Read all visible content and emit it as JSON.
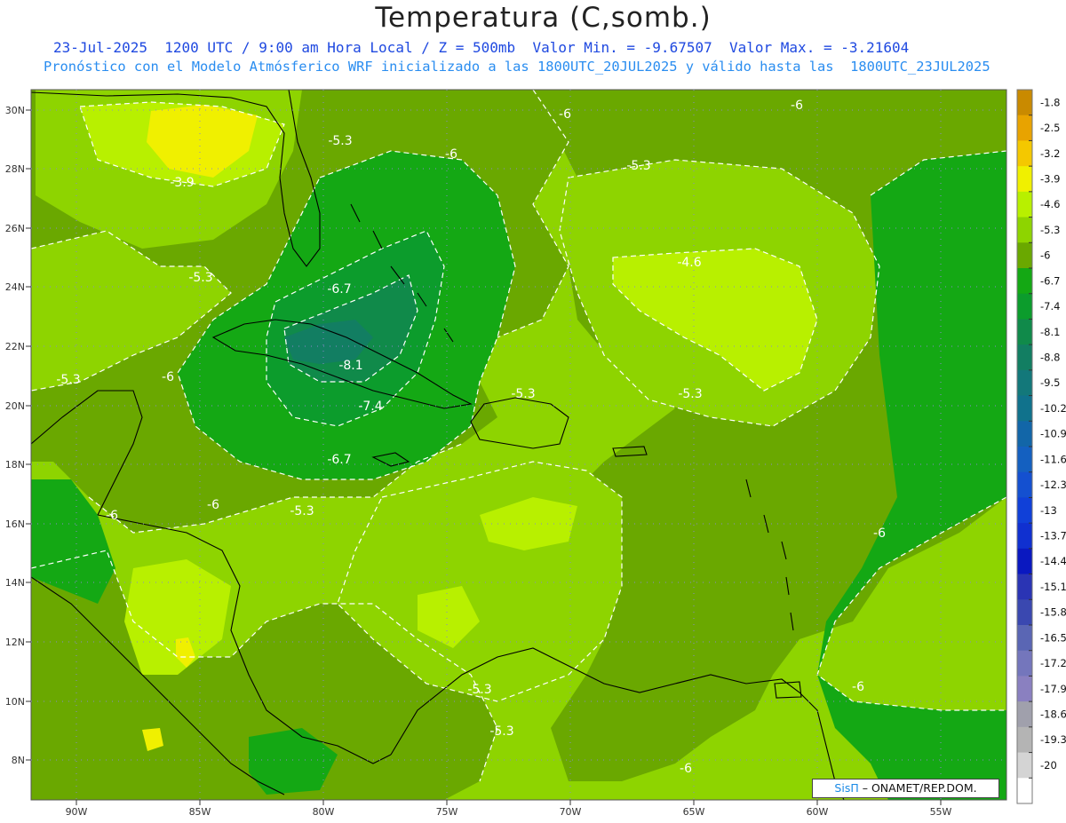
{
  "header": {
    "title": "Temperatura (C,somb.)",
    "line1": "23-Jul-2025  1200 UTC / 9:00 am Hora Local / Z = 500mb  Valor Min. = -9.67507  Valor Max. = -3.21604",
    "line2": "Pronóstico con el Modelo Atmósferico WRF inicializado a las 1800UTC_20JUL2025 y válido hasta las  1800UTC_23JUL2025"
  },
  "map": {
    "lat_ticks": [
      "30N",
      "28N",
      "26N",
      "24N",
      "22N",
      "20N",
      "18N",
      "16N",
      "14N",
      "12N",
      "10N",
      "8N"
    ],
    "lon_ticks": [
      "90W",
      "85W",
      "80W",
      "75W",
      "70W",
      "65W",
      "60W",
      "55W"
    ],
    "contour_labels": [
      "-6",
      "-6",
      "-5.3",
      "-6",
      "-5.3",
      "-3.9",
      "-5.3",
      "-6.7",
      "-4.6",
      "-5.3",
      "-6",
      "-8.1",
      "-5.3",
      "-5.3",
      "-7.4",
      "-6.7",
      "-6",
      "-5.3",
      "-6",
      "-6",
      "-5.3",
      "-5.3",
      "-6",
      "-6"
    ],
    "field_colors": {
      "c_1_8": "#c98a00",
      "c_2_5": "#e8a300",
      "c_3_2": "#f4c800",
      "c_3_9": "#f0f000",
      "c_4_6": "#b8f000",
      "c_5_3": "#8ed400",
      "c_6": "#6aa800",
      "c_6_7": "#14a814",
      "c_7_4": "#0c9c2c",
      "c_8_1": "#108a4a",
      "c_8_8": "#127e62"
    }
  },
  "colorbar": {
    "levels": [
      "-1.8",
      "-2.5",
      "-3.2",
      "-3.9",
      "-4.6",
      "-5.3",
      "-6",
      "-6.7",
      "-7.4",
      "-8.1",
      "-8.8",
      "-9.5",
      "-10.2",
      "-10.9",
      "-11.6",
      "-12.3",
      "-13",
      "-13.7",
      "-14.4",
      "-15.1",
      "-15.8",
      "-16.5",
      "-17.2",
      "-17.9",
      "-18.6",
      "-19.3",
      "-20"
    ],
    "colors": [
      "#c98a00",
      "#e8a300",
      "#f4c800",
      "#f0f000",
      "#b8f000",
      "#8ed400",
      "#6aa800",
      "#14a814",
      "#0c9c2c",
      "#108a4a",
      "#127e62",
      "#13787a",
      "#10728c",
      "#1266a8",
      "#1460c0",
      "#1450d0",
      "#1040d8",
      "#1030d0",
      "#0a18c0",
      "#2a34b4",
      "#3a48b0",
      "#5a66b4",
      "#7476bc",
      "#8a80c0",
      "#a0a0ac",
      "#b4b4b4",
      "#d4d4d4",
      "#ffffff"
    ]
  },
  "credit": {
    "brand": "SisΠ",
    "text": "– ONAMET/REP.DOM."
  }
}
